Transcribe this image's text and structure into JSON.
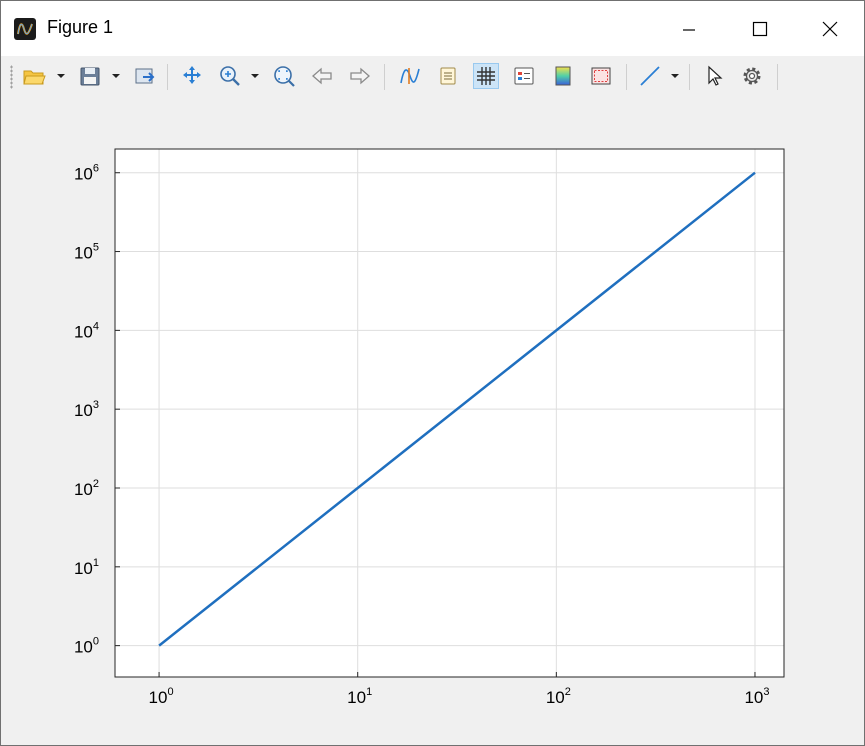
{
  "window": {
    "title": "Figure 1",
    "app_icon": "figure-app-icon",
    "controls": [
      "minimize-icon",
      "maximize-icon",
      "close-icon"
    ]
  },
  "toolbar": {
    "items": [
      {
        "name": "open-folder-icon",
        "dropdown": true
      },
      {
        "name": "save-disk-icon",
        "dropdown": true
      },
      {
        "name": "export-figure-icon"
      },
      {
        "name": "pan-icon"
      },
      {
        "name": "zoom-in-icon",
        "dropdown": true
      },
      {
        "name": "zoom-fit-icon"
      },
      {
        "name": "back-arrow-icon"
      },
      {
        "name": "forward-arrow-icon"
      },
      {
        "name": "data-cursor-icon"
      },
      {
        "name": "text-annotation-icon"
      },
      {
        "name": "grid-toggle-icon",
        "active": true
      },
      {
        "name": "legend-icon"
      },
      {
        "name": "colorbar-icon"
      },
      {
        "name": "box-icon"
      },
      {
        "name": "line-style-icon",
        "dropdown": true
      },
      {
        "name": "select-pointer-icon"
      },
      {
        "name": "settings-gear-icon"
      }
    ]
  },
  "chart_data": {
    "type": "line",
    "title": "",
    "xlabel": "",
    "ylabel": "",
    "x_scale": "log",
    "y_scale": "log",
    "xlim": [
      0.6,
      1400
    ],
    "ylim": [
      0.4,
      2000000
    ],
    "x_ticks": [
      {
        "value": 1,
        "base": "10",
        "exp": "0"
      },
      {
        "value": 10,
        "base": "10",
        "exp": "1"
      },
      {
        "value": 100,
        "base": "10",
        "exp": "2"
      },
      {
        "value": 1000,
        "base": "10",
        "exp": "3"
      }
    ],
    "y_ticks": [
      {
        "value": 1,
        "base": "10",
        "exp": "0"
      },
      {
        "value": 10,
        "base": "10",
        "exp": "1"
      },
      {
        "value": 100,
        "base": "10",
        "exp": "2"
      },
      {
        "value": 1000,
        "base": "10",
        "exp": "3"
      },
      {
        "value": 10000,
        "base": "10",
        "exp": "4"
      },
      {
        "value": 100000,
        "base": "10",
        "exp": "5"
      },
      {
        "value": 1000000,
        "base": "10",
        "exp": "6"
      }
    ],
    "grid": true,
    "series": [
      {
        "color": "#1f6fbf",
        "x": [
          1,
          10,
          100,
          1000
        ],
        "y": [
          1,
          100,
          10000,
          1000000
        ]
      }
    ]
  }
}
